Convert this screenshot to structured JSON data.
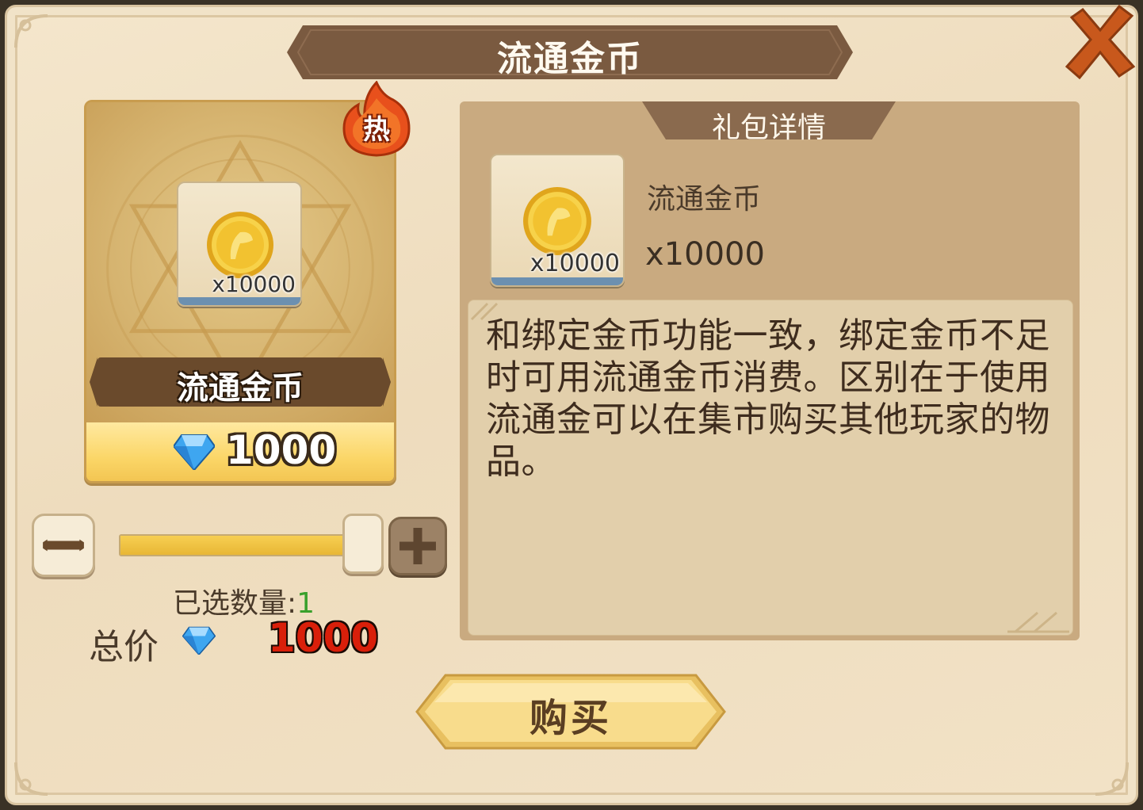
{
  "title": "流通金币",
  "close_icon": "close-x-icon",
  "hot_badge": "热",
  "product": {
    "name": "流通金币",
    "quantity_label": "x10000",
    "price": "1000",
    "icon": "gold-coin-icon",
    "currency_icon": "diamond-gem-icon"
  },
  "quantity": {
    "selected_label": "已选数量:",
    "selected_value": "1",
    "slider_fraction": 1.0
  },
  "total": {
    "label": "总价",
    "value": "1000"
  },
  "details": {
    "header": "礼包详情",
    "item_name": "流通金币",
    "item_quantity": "x10000",
    "icon_quantity": "x10000",
    "description": "和绑定金币功能一致，绑定金币不足时可用流通金币消费。区别在于使用流通金可以在集市购买其他玩家的物品。"
  },
  "buy_button": "购买",
  "colors": {
    "accent_gold": "#f2c451",
    "title_banner": "#7a5a40",
    "price_red": "#d91f0a",
    "qty_green": "#39a02c",
    "close_orange": "#c8581c"
  }
}
